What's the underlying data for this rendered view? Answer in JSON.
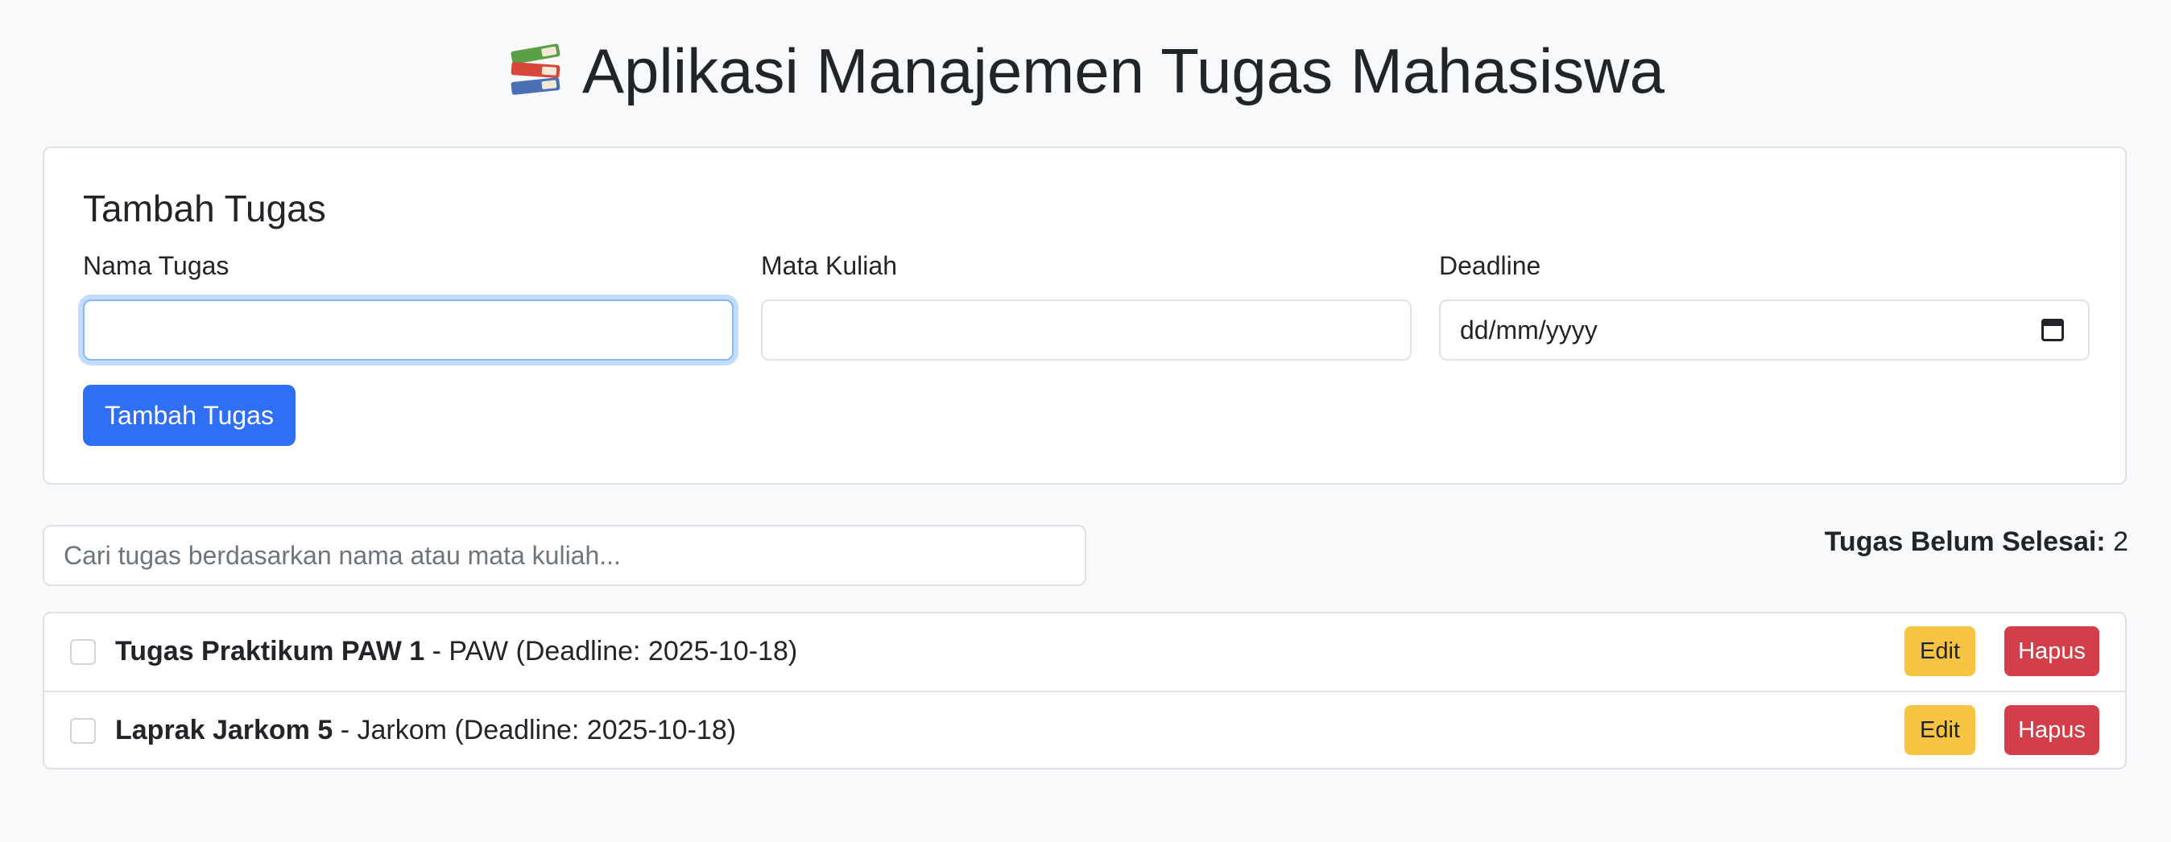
{
  "header": {
    "icon": "books-icon",
    "title": "Aplikasi Manajemen Tugas Mahasiswa"
  },
  "add_form": {
    "title": "Tambah Tugas",
    "fields": [
      {
        "label": "Nama Tugas",
        "value": ""
      },
      {
        "label": "Mata Kuliah",
        "value": ""
      },
      {
        "label": "Deadline",
        "value": "dd/mm/yyyy"
      }
    ],
    "submit_label": "Tambah Tugas"
  },
  "search": {
    "placeholder": "Cari tugas berdasarkan nama atau mata kuliah..."
  },
  "pending": {
    "label": "Tugas Belum Selesai:",
    "count": "2"
  },
  "tasks": [
    {
      "name": "Tugas Praktikum PAW 1",
      "detail": " - PAW (Deadline: 2025-10-18)",
      "done": false,
      "edit_label": "Edit",
      "delete_label": "Hapus"
    },
    {
      "name": "Laprak Jarkom 5",
      "detail": " - Jarkom (Deadline: 2025-10-18)",
      "done": false,
      "edit_label": "Edit",
      "delete_label": "Hapus"
    }
  ],
  "colors": {
    "primary": "#2f6ff5",
    "warning": "#f6c343",
    "danger": "#d23f4a",
    "background": "#f8f9fa"
  }
}
